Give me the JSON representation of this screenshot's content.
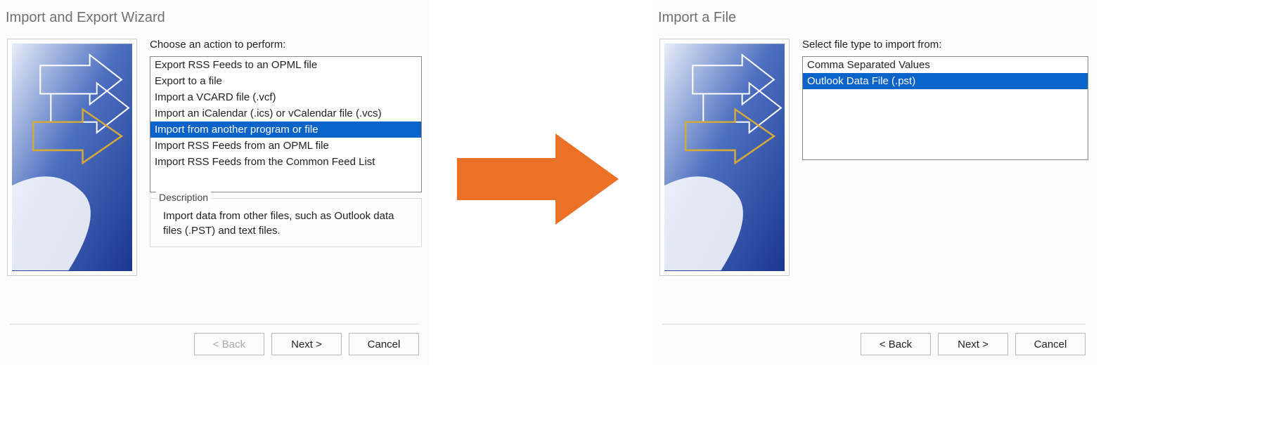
{
  "dialog1": {
    "title": "Import and Export Wizard",
    "prompt": "Choose an action to perform:",
    "actions": [
      {
        "label": "Export RSS Feeds to an OPML file",
        "selected": false
      },
      {
        "label": "Export to a file",
        "selected": false
      },
      {
        "label": "Import a VCARD file (.vcf)",
        "selected": false
      },
      {
        "label": "Import an iCalendar (.ics) or vCalendar file (.vcs)",
        "selected": false
      },
      {
        "label": "Import from another program or file",
        "selected": true
      },
      {
        "label": "Import RSS Feeds from an OPML file",
        "selected": false
      },
      {
        "label": "Import RSS Feeds from the Common Feed List",
        "selected": false
      }
    ],
    "descriptionTitle": "Description",
    "descriptionText": "Import data from other files, such as Outlook data files (.PST) and text files.",
    "buttons": {
      "back": "< Back",
      "next": "Next >",
      "cancel": "Cancel"
    },
    "backEnabled": false
  },
  "dialog2": {
    "title": "Import a File",
    "prompt": "Select file type to import from:",
    "fileTypes": [
      {
        "label": "Comma Separated Values",
        "selected": false
      },
      {
        "label": "Outlook Data File (.pst)",
        "selected": true
      }
    ],
    "buttons": {
      "back": "< Back",
      "next": "Next >",
      "cancel": "Cancel"
    },
    "backEnabled": true
  },
  "colors": {
    "selection": "#0a63c9",
    "arrow": "#ea7125"
  }
}
